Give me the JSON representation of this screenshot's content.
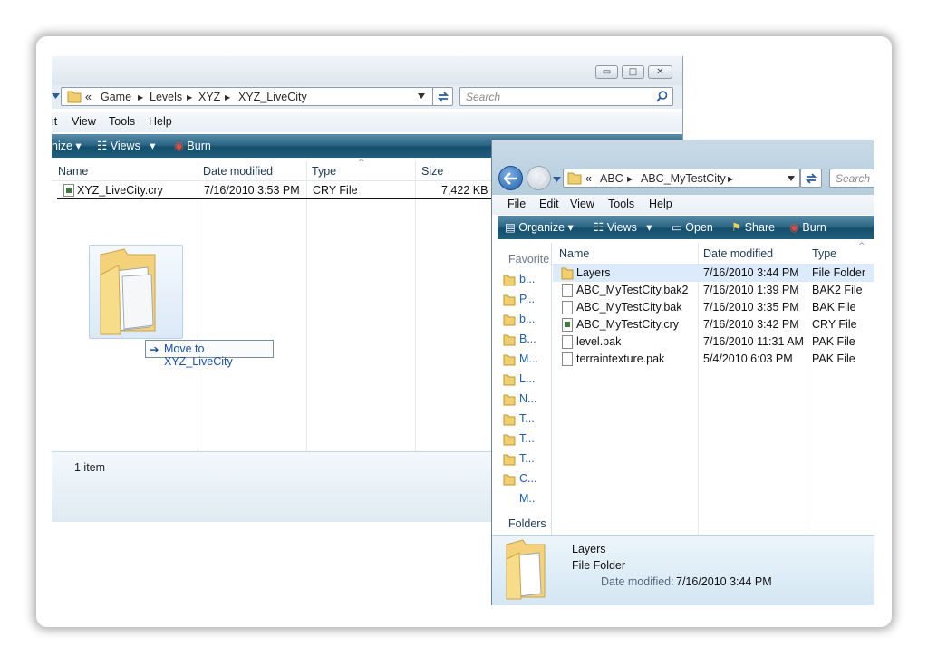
{
  "back_window": {
    "breadcrumb": [
      "«",
      "Game",
      "Levels",
      "XYZ",
      "XYZ_LiveCity"
    ],
    "search_placeholder": "Search",
    "menu": [
      "it",
      "View",
      "Tools",
      "Help"
    ],
    "toolbar": {
      "organize": "nize",
      "views": "Views",
      "burn": "Burn"
    },
    "columns": {
      "name": "Name",
      "date": "Date modified",
      "type": "Type",
      "size": "Size"
    },
    "files": [
      {
        "name": "XYZ_LiveCity.cry",
        "date": "7/16/2010 3:53 PM",
        "type": "CRY File",
        "size": "7,422 KB"
      }
    ],
    "drag_tooltip": "Move to XYZ_LiveCity",
    "status": "1 item"
  },
  "front_window": {
    "breadcrumb": [
      "«",
      "ABC",
      "ABC_MyTestCity"
    ],
    "search_placeholder": "Search",
    "menu": [
      "File",
      "Edit",
      "View",
      "Tools",
      "Help"
    ],
    "toolbar": {
      "organize": "Organize",
      "views": "Views",
      "open": "Open",
      "share": "Share",
      "burn": "Burn"
    },
    "sidebar": {
      "favorites_label": "Favorite",
      "items": [
        "b...",
        "P...",
        "b...",
        "B...",
        "M...",
        "L...",
        "N...",
        "T...",
        "T...",
        "T...",
        "C...",
        "M.."
      ],
      "folders_label": "Folders"
    },
    "columns": {
      "name": "Name",
      "date": "Date modified",
      "type": "Type"
    },
    "files": [
      {
        "name": "Layers",
        "date": "7/16/2010 3:44 PM",
        "type": "File Folder",
        "icon": "folder-icon"
      },
      {
        "name": "ABC_MyTestCity.bak2",
        "date": "7/16/2010 1:39 PM",
        "type": "BAK2 File",
        "icon": "file-icon"
      },
      {
        "name": "ABC_MyTestCity.bak",
        "date": "7/16/2010 3:35 PM",
        "type": "BAK File",
        "icon": "file-icon"
      },
      {
        "name": "ABC_MyTestCity.cry",
        "date": "7/16/2010 3:42 PM",
        "type": "CRY File",
        "icon": "cry-file-icon"
      },
      {
        "name": "level.pak",
        "date": "7/16/2010 11:31 AM",
        "type": "PAK File",
        "icon": "file-icon"
      },
      {
        "name": "terraintexture.pak",
        "date": "5/4/2010 6:03 PM",
        "type": "PAK File",
        "icon": "file-icon"
      }
    ],
    "details": {
      "name": "Layers",
      "type": "File Folder",
      "date_label": "Date modified:",
      "date_value": "7/16/2010 3:44 PM"
    }
  },
  "colors": {
    "toolbar_dark": "#144f6d",
    "link_blue": "#1b5eb0",
    "folder_yellow": "#f3d27a",
    "selection": "#dcebfc"
  }
}
